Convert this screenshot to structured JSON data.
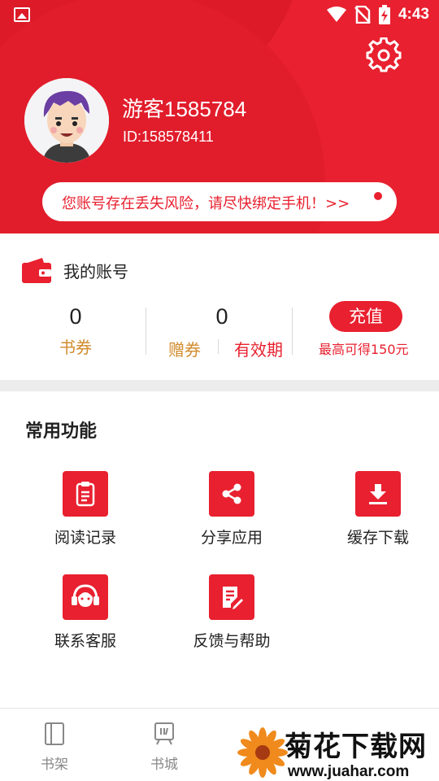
{
  "status_bar": {
    "time": "4:43",
    "icons": [
      "photo-icon",
      "wifi-icon",
      "no-sim-icon",
      "battery-charging-icon"
    ]
  },
  "profile": {
    "username": "游客1585784",
    "user_id": "ID:158578411",
    "notice": "您账号存在丢失风险，请尽快绑定手机！>>"
  },
  "account": {
    "title": "我的账号",
    "book_coupon": {
      "value": "0",
      "label": "书券"
    },
    "gift_coupon": {
      "value": "0",
      "label": "赠券",
      "extra_label": "有效期"
    },
    "recharge_label": "充值",
    "recharge_note": "最高可得150元"
  },
  "functions": {
    "title": "常用功能",
    "items": [
      {
        "label": "阅读记录",
        "icon": "clipboard-icon"
      },
      {
        "label": "分享应用",
        "icon": "share-icon"
      },
      {
        "label": "缓存下载",
        "icon": "download-icon"
      },
      {
        "label": "联系客服",
        "icon": "headset-icon"
      },
      {
        "label": "反馈与帮助",
        "icon": "edit-document-icon"
      }
    ]
  },
  "bottom_nav": {
    "items": [
      {
        "label": "书架",
        "icon": "bookshelf-icon"
      },
      {
        "label": "书城",
        "icon": "bookstore-icon"
      }
    ]
  },
  "watermark": {
    "text": "菊花下载网",
    "url": "www.juahar.com"
  },
  "colors": {
    "brand_red": "#e8202f",
    "coupon_label": "#d18b2c"
  }
}
